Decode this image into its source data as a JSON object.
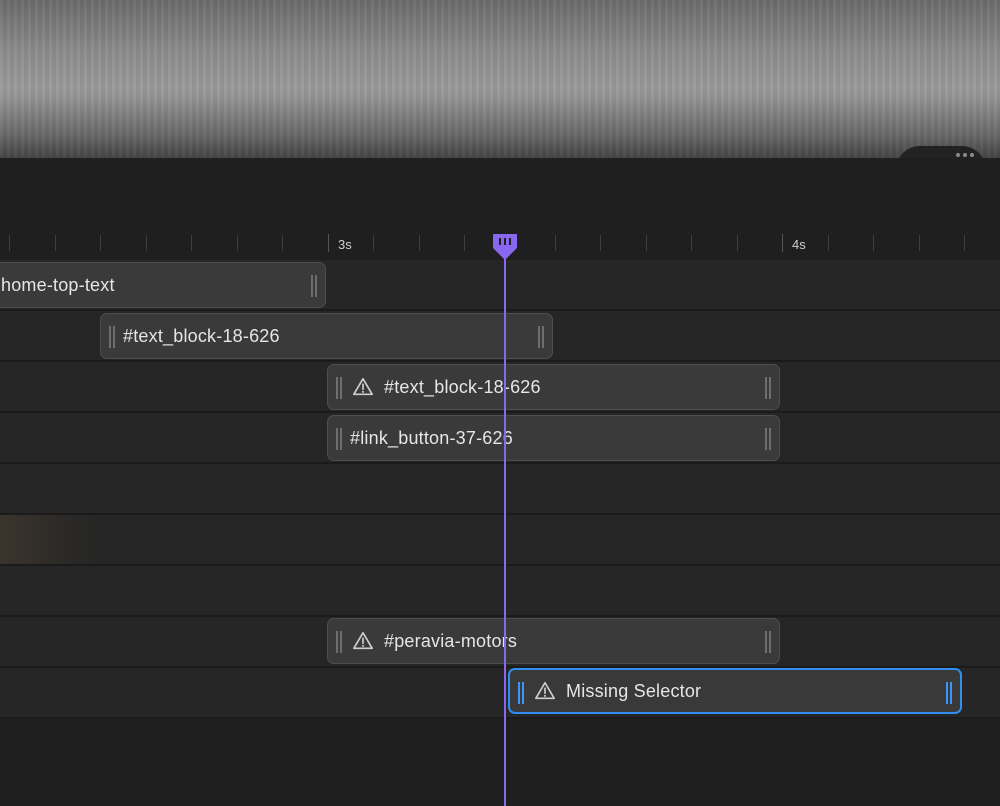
{
  "ruler": {
    "labels": [
      "3s",
      "4s"
    ]
  },
  "tracks": [
    {
      "label": "home-top-text",
      "warning": false,
      "selected": false
    },
    {
      "label": "#text_block-18-626",
      "warning": false,
      "selected": false
    },
    {
      "label": "#text_block-18-626",
      "warning": true,
      "selected": false
    },
    {
      "label": "#link_button-37-626",
      "warning": false,
      "selected": false
    },
    {
      "label": "#peravia-motors",
      "warning": true,
      "selected": false
    },
    {
      "label": "Missing Selector",
      "warning": true,
      "selected": true
    }
  ],
  "colors": {
    "playhead": "#8a67f0",
    "selection": "#2f8ef0",
    "clip_bg": "#3a3a3a",
    "row_bg": "#262626"
  },
  "icons": {
    "warning": "warning-triangle-icon",
    "playhead": "playhead-marker-icon",
    "grip": "resize-grip-icon"
  }
}
